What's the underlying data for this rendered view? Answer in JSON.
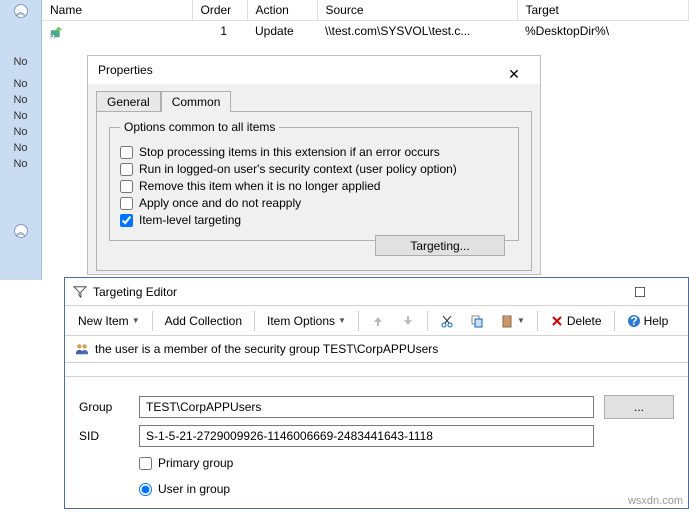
{
  "sidebar": {
    "labels": [
      "No",
      "No",
      "No",
      "No",
      "No",
      "No",
      "No"
    ]
  },
  "grid": {
    "headers": {
      "name": "Name",
      "order": "Order",
      "action": "Action",
      "source": "Source",
      "target": "Target"
    },
    "row": {
      "name": "",
      "order": "1",
      "action": "Update",
      "source": "\\\\test.com\\SYSVOL\\test.c...",
      "target": "%DesktopDir%\\"
    }
  },
  "properties": {
    "title": "Properties",
    "tabs": {
      "general": "General",
      "common": "Common"
    },
    "legend": "Options common to all items",
    "opts": {
      "stop": "Stop processing items in this extension if an error occurs",
      "run": "Run in logged-on user's security context (user policy option)",
      "remove": "Remove this item when it is no longer applied",
      "applyonce": "Apply once and do not reapply",
      "ilt": "Item-level targeting"
    },
    "targeting_btn": "Targeting..."
  },
  "targeting_editor": {
    "title": "Targeting Editor",
    "toolbar": {
      "new_item": "New Item",
      "add_collection": "Add Collection",
      "item_options": "Item Options",
      "delete": "Delete",
      "help": "Help"
    },
    "rule": "the user is a member of the security group TEST\\CorpAPPUsers",
    "form": {
      "group_label": "Group",
      "group_value": "TEST\\CorpAPPUsers",
      "sid_label": "SID",
      "sid_value": "S-1-5-21-2729009926-1146006669-2483441643-1118",
      "primary": "Primary group",
      "user_in_group": "User in group",
      "browse": "..."
    }
  },
  "watermark": "wsxdn.com"
}
